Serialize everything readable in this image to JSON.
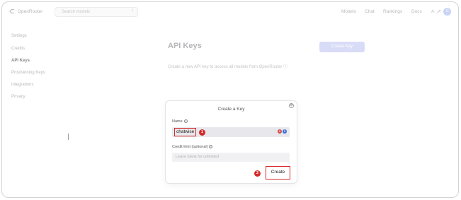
{
  "topbar": {
    "brand": "OpenRouter",
    "search_placeholder": "Search models",
    "search_shortcut": "/",
    "nav": [
      "Models",
      "Chat",
      "Rankings",
      "Docs"
    ],
    "avatar_initial": "C"
  },
  "sidebar": {
    "items": [
      {
        "label": "Settings",
        "active": false
      },
      {
        "label": "Credits",
        "active": false
      },
      {
        "label": "API Keys",
        "active": true
      },
      {
        "label": "Provisioning Keys",
        "active": false
      },
      {
        "label": "Integrations",
        "active": false
      },
      {
        "label": "Privacy",
        "active": false
      }
    ]
  },
  "page": {
    "title": "API Keys",
    "create_key_label": "Create Key",
    "description": "Create a new API key to access all models from OpenRouter ⓘ"
  },
  "modal": {
    "title": "Create a Key",
    "close_icon": "⊗",
    "name_label": "Name",
    "name_value": "chatwise",
    "credit_label": "Credit limit (optional)",
    "credit_placeholder": "Leave blank for unlimited",
    "create_label": "Create",
    "info_glyph": "i"
  },
  "markers": {
    "first": "1",
    "second": "2"
  },
  "colors": {
    "accent": "#d9dcf7",
    "annotation": "#d42a2a"
  }
}
